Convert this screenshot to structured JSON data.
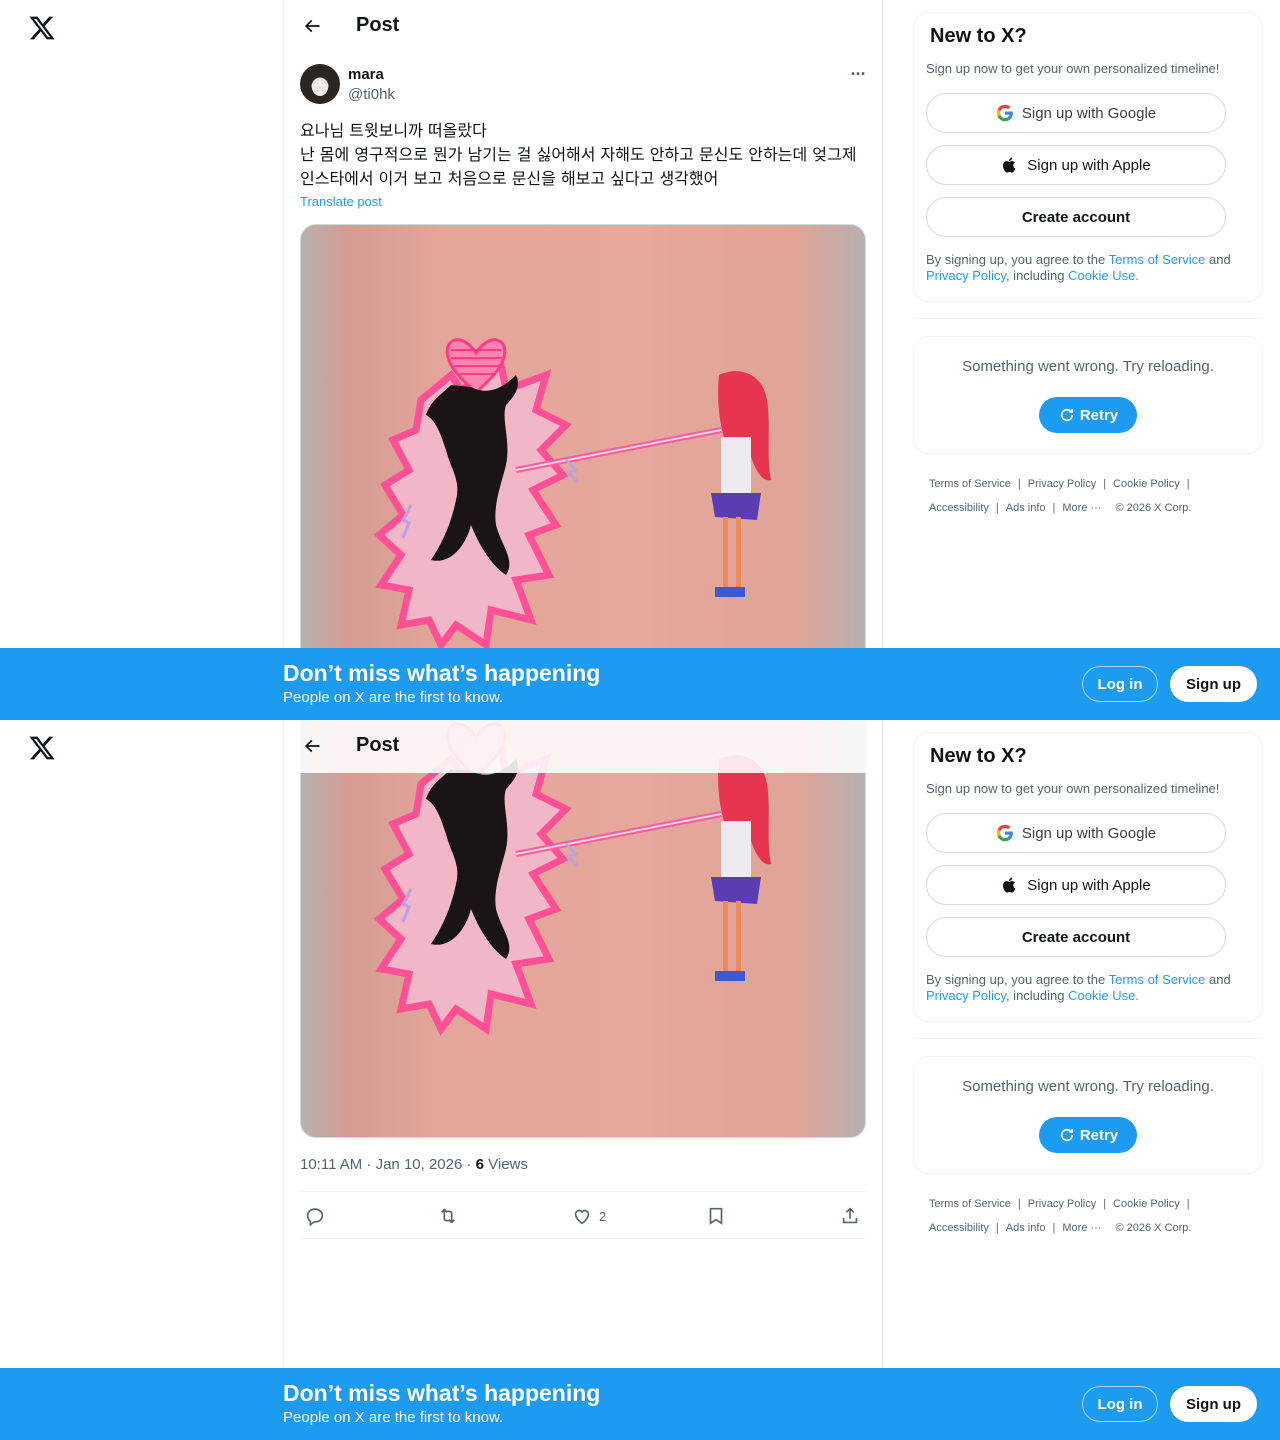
{
  "header": {
    "title": "Post"
  },
  "post": {
    "author_name": "mara",
    "author_handle": "@ti0hk",
    "text": "요나님 트윗보니까 떠올랐다\n난 몸에 영구적으로 뭔가 남기는 걸 싫어해서 자해도 안하고 문신도 안하는데 엊그제 인스타에서 이거 보고 처음으로 문신을 해보고 싶다고 생각했어",
    "translate_label": "Translate post",
    "timestamp": "10:11 AM · Jan 10, 2026 · ",
    "views_count": "6",
    "views_label": " Views",
    "like_count": "2"
  },
  "signup_card": {
    "title": "New to X?",
    "subtitle": "Sign up now to get your own personalized timeline!",
    "google_label": "Sign up with Google",
    "apple_label": "Sign up with Apple",
    "create_label": "Create account",
    "legal_prefix": "By signing up, you agree to the ",
    "terms_link": "Terms of Service",
    "legal_and": " and ",
    "privacy_link": "Privacy Policy",
    "legal_including": ", including ",
    "cookie_link": "Cookie Use."
  },
  "error_card": {
    "message": "Something went wrong. Try reloading.",
    "retry_label": "Retry"
  },
  "footer": {
    "terms": "Terms of Service",
    "privacy": "Privacy Policy",
    "cookie": "Cookie Policy",
    "accessibility": "Accessibility",
    "ads": "Ads info",
    "more": "More ···",
    "copyright": "© 2026 X Corp."
  },
  "banner": {
    "title": "Don’t miss what’s happening",
    "subtitle": "People on X are the first to know.",
    "login_label": "Log in",
    "signup_label": "Sign up"
  },
  "colors": {
    "accent": "#1d9bf0",
    "text": "#0f1419",
    "muted": "#536471",
    "border": "#eff3f4"
  },
  "icons": [
    "x-logo-icon",
    "back-arrow-icon",
    "more-icon",
    "reply-icon",
    "repost-icon",
    "like-icon",
    "bookmark-icon",
    "share-icon",
    "google-icon",
    "apple-icon",
    "retry-icon"
  ]
}
